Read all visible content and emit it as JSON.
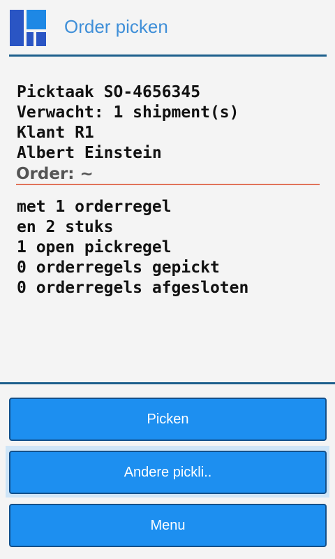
{
  "header": {
    "title": "Order picken",
    "logo_icon": "tiles-logo-icon"
  },
  "info": {
    "lines": [
      "Picktaak SO-4656345",
      "Verwacht: 1 shipment(s)",
      "Klant R1",
      "Albert Einstein"
    ]
  },
  "order_field": {
    "label": "Order: ~",
    "value": ""
  },
  "stats": {
    "lines": [
      "met 1 orderregel",
      "en 2 stuks",
      "1 open pickregel",
      "0 orderregels gepickt",
      "0 orderregels afgesloten"
    ]
  },
  "buttons": {
    "picken": "Picken",
    "andere": "Andere pickli..",
    "menu": "Menu"
  },
  "colors": {
    "title": "#3f8fd8",
    "rule": "#1d5f8c",
    "button": "#1d8ff0",
    "underline": "#e0735a"
  }
}
